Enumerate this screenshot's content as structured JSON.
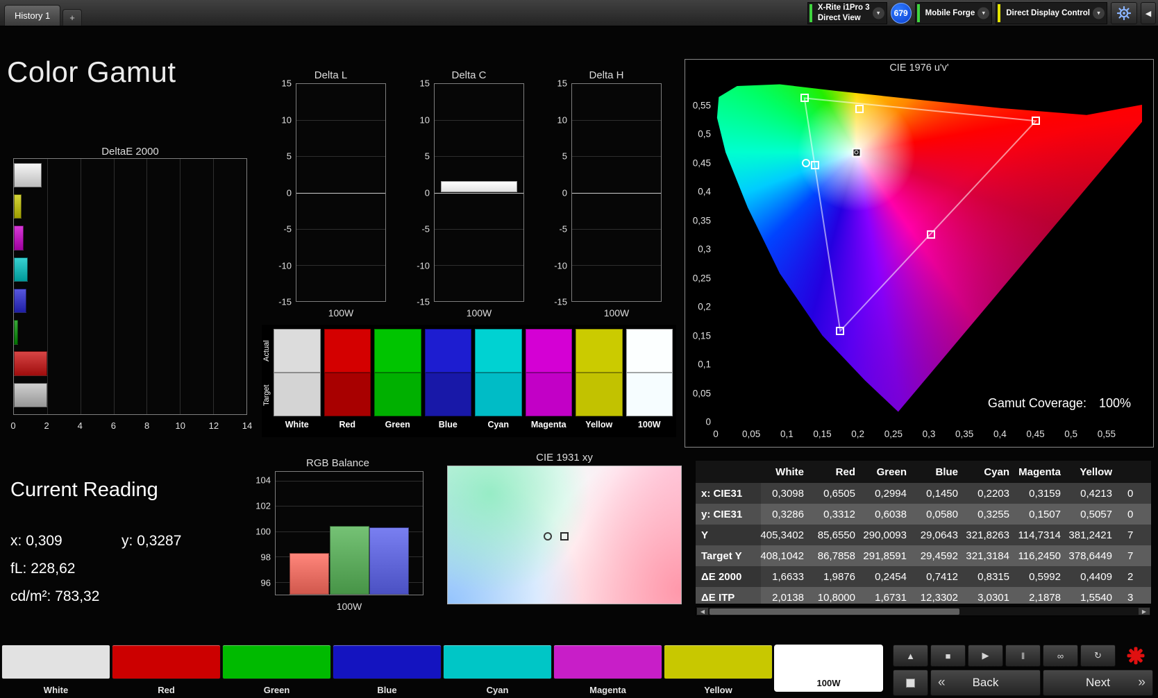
{
  "topbar": {
    "history_tab": "History 1",
    "add_tab_label": "+",
    "badge_value": "679",
    "meters": [
      {
        "name": "xrite-i1pro3",
        "line1": "X-Rite i1Pro 3",
        "line2": "Direct View",
        "accent": "#3fd43f"
      },
      {
        "name": "mobile-forge",
        "line1": "Mobile Forge",
        "line2": "",
        "accent": "#3fd43f"
      },
      {
        "name": "direct-display-control",
        "line1": "Direct Display Control",
        "line2": "",
        "accent": "#e3e300"
      }
    ]
  },
  "icons": {
    "dropdown": "▾",
    "collapse": "◀",
    "scroll_left": "◀",
    "scroll_right": "▶"
  },
  "page_title": "Color Gamut",
  "current_reading": {
    "title": "Current Reading",
    "x_label": "x:",
    "x_value": "0,309",
    "y_label": "y:",
    "y_value": "0,3287",
    "fl_label": "fL:",
    "fl_value": "228,62",
    "cd_label": "cd/m²:",
    "cd_value": "783,32"
  },
  "gamut_panel": {
    "coverage_label": "Gamut Coverage:",
    "coverage_value": "100%"
  },
  "swatch_strip": {
    "row_labels": [
      "Actual",
      "Target"
    ],
    "columns": [
      {
        "label": "White",
        "actual": "#dcdcdc",
        "target": "#d4d4d4"
      },
      {
        "label": "Red",
        "actual": "#d40000",
        "target": "#a80000"
      },
      {
        "label": "Green",
        "actual": "#00c400",
        "target": "#00b000"
      },
      {
        "label": "Blue",
        "actual": "#1d1dd0",
        "target": "#1818a8"
      },
      {
        "label": "Cyan",
        "actual": "#00d2d2",
        "target": "#00bcc6"
      },
      {
        "label": "Magenta",
        "actual": "#d400d4",
        "target": "#c200c6"
      },
      {
        "label": "Yellow",
        "actual": "#cbcb00",
        "target": "#c2c200"
      },
      {
        "label": "100W",
        "actual": "#fcffff",
        "target": "#f6fdff"
      }
    ]
  },
  "chart_data": [
    {
      "id": "deltae2000",
      "type": "bar",
      "orientation": "horizontal",
      "title": "DeltaE 2000",
      "categories": [
        "White",
        "Yellow",
        "Magenta",
        "Cyan",
        "Blue",
        "Green",
        "Red",
        "100W"
      ],
      "values": [
        1.66,
        0.44,
        0.6,
        0.83,
        0.74,
        0.25,
        1.99,
        2.01
      ],
      "colors": [
        "#f2f2f2",
        "#c9c900",
        "#cc00cc",
        "#00c4c4",
        "#2828d4",
        "#009100",
        "#cc1111",
        "#c2c2c2"
      ],
      "xlim": [
        0,
        14
      ],
      "x_ticks": [
        0,
        2,
        4,
        6,
        8,
        10,
        12,
        14
      ]
    },
    {
      "id": "delta_l",
      "type": "bar",
      "title": "Delta L",
      "categories": [
        "100W"
      ],
      "values": [
        0
      ],
      "ylim": [
        -15,
        15
      ],
      "y_ticks": [
        15,
        10,
        5,
        0,
        -5,
        -10,
        -15
      ],
      "xlabel": "100W"
    },
    {
      "id": "delta_c",
      "type": "bar",
      "title": "Delta C",
      "categories": [
        "100W"
      ],
      "values": [
        1.6
      ],
      "ylim": [
        -15,
        15
      ],
      "y_ticks": [
        15,
        10,
        5,
        0,
        -5,
        -10,
        -15
      ],
      "xlabel": "100W"
    },
    {
      "id": "delta_h",
      "type": "bar",
      "title": "Delta H",
      "categories": [
        "100W"
      ],
      "values": [
        0
      ],
      "ylim": [
        -15,
        15
      ],
      "y_ticks": [
        15,
        10,
        5,
        0,
        -5,
        -10,
        -15
      ],
      "xlabel": "100W"
    },
    {
      "id": "rgb_balance",
      "type": "bar",
      "title": "RGB Balance",
      "categories": [
        "Red",
        "Green",
        "Blue"
      ],
      "values": [
        98.3,
        100.4,
        100.3
      ],
      "colors": [
        "#ff6b5e",
        "#57b457",
        "#5c63ee"
      ],
      "ylim": [
        95,
        104.7
      ],
      "y_ticks": [
        104,
        102,
        100,
        98,
        96
      ],
      "xlabel": "100W"
    },
    {
      "id": "cie1976",
      "type": "scatter",
      "title": "CIE 1976 u'v'",
      "xlabel": "u'",
      "ylabel": "v'",
      "tick_values": [
        0,
        0.05,
        0.1,
        0.15,
        0.2,
        0.25,
        0.3,
        0.35,
        0.4,
        0.45,
        0.5,
        0.55
      ],
      "axis_max": 0.6,
      "triangle": [
        [
          20.8,
          6.3
        ],
        [
          75.1,
          12.9
        ],
        [
          29.2,
          73.7
        ]
      ],
      "points": [
        {
          "name": "green-primary",
          "shape": "square",
          "x_pct": 20.8,
          "y_pct": 6.3
        },
        {
          "name": "yellow-secondary",
          "shape": "square",
          "x_pct": 33.7,
          "y_pct": 9.5
        },
        {
          "name": "red-primary",
          "shape": "square",
          "x_pct": 75.1,
          "y_pct": 12.9
        },
        {
          "name": "cyan-reference",
          "shape": "circle",
          "x_pct": 21.2,
          "y_pct": 25.0
        },
        {
          "name": "cyan-secondary",
          "shape": "square",
          "x_pct": 23.3,
          "y_pct": 25.8
        },
        {
          "name": "white-point",
          "shape": "filled-square",
          "x_pct": 33.0,
          "y_pct": 22.0
        },
        {
          "name": "magenta-secondary",
          "shape": "square",
          "x_pct": 50.5,
          "y_pct": 45.7
        },
        {
          "name": "blue-primary",
          "shape": "square",
          "x_pct": 29.2,
          "y_pct": 73.7
        }
      ],
      "coverage": "100%"
    },
    {
      "id": "cie1931",
      "type": "scatter",
      "title": "CIE 1931 xy",
      "points": [
        {
          "name": "target-point",
          "shape": "circle",
          "x_pct": 43.0,
          "y_pct": 51.0,
          "color": "#3a3a3a"
        },
        {
          "name": "measured-point",
          "shape": "square",
          "x_pct": 50.0,
          "y_pct": 51.0,
          "color": "#2a2a2a"
        }
      ]
    }
  ],
  "table": {
    "columns": [
      "White",
      "Red",
      "Green",
      "Blue",
      "Cyan",
      "Magenta",
      "Yellow"
    ],
    "rows": [
      {
        "label": "x: CIE31",
        "values": [
          "0,3098",
          "0,6505",
          "0,2994",
          "0,1450",
          "0,2203",
          "0,3159",
          "0,4213",
          "0"
        ]
      },
      {
        "label": "y: CIE31",
        "values": [
          "0,3286",
          "0,3312",
          "0,6038",
          "0,0580",
          "0,3255",
          "0,1507",
          "0,5057",
          "0"
        ]
      },
      {
        "label": "Y",
        "values": [
          "405,3402",
          "85,6550",
          "290,0093",
          "29,0643",
          "321,8263",
          "114,7314",
          "381,2421",
          "7"
        ]
      },
      {
        "label": "Target Y",
        "values": [
          "408,1042",
          "86,7858",
          "291,8591",
          "29,4592",
          "321,3184",
          "116,2450",
          "378,6449",
          "7"
        ]
      },
      {
        "label": "ΔE 2000",
        "values": [
          "1,6633",
          "1,9876",
          "0,2454",
          "0,7412",
          "0,8315",
          "0,5992",
          "0,4409",
          "2"
        ]
      },
      {
        "label": "ΔE ITP",
        "values": [
          "2,0138",
          "10,8000",
          "1,6731",
          "12,3302",
          "3,0301",
          "2,1878",
          "1,5540",
          "3"
        ]
      }
    ]
  },
  "bottom": {
    "patches": [
      {
        "label": "White",
        "color": "#e2e2e2"
      },
      {
        "label": "Red",
        "color": "#cc0000"
      },
      {
        "label": "Green",
        "color": "#00ba00"
      },
      {
        "label": "Blue",
        "color": "#1414c0"
      },
      {
        "label": "Cyan",
        "color": "#00c6c6"
      },
      {
        "label": "Magenta",
        "color": "#c81ec8"
      },
      {
        "label": "Yellow",
        "color": "#c8c800"
      },
      {
        "label": "100W",
        "color": "#ffffff",
        "selected": true
      }
    ],
    "transport": [
      {
        "name": "collapse-up",
        "glyph": "▲"
      },
      {
        "name": "stop",
        "glyph": "■"
      },
      {
        "name": "play",
        "glyph": "▶"
      },
      {
        "name": "pause",
        "glyph": "‖"
      },
      {
        "name": "continuous",
        "glyph": "∞"
      },
      {
        "name": "refresh",
        "glyph": "↻"
      },
      {
        "name": "alert-asterisk",
        "glyph": "✱",
        "color": "#e01010"
      }
    ],
    "back_chevron": "«",
    "back_label": "Back",
    "next_label": "Next",
    "next_chevron": "»"
  }
}
